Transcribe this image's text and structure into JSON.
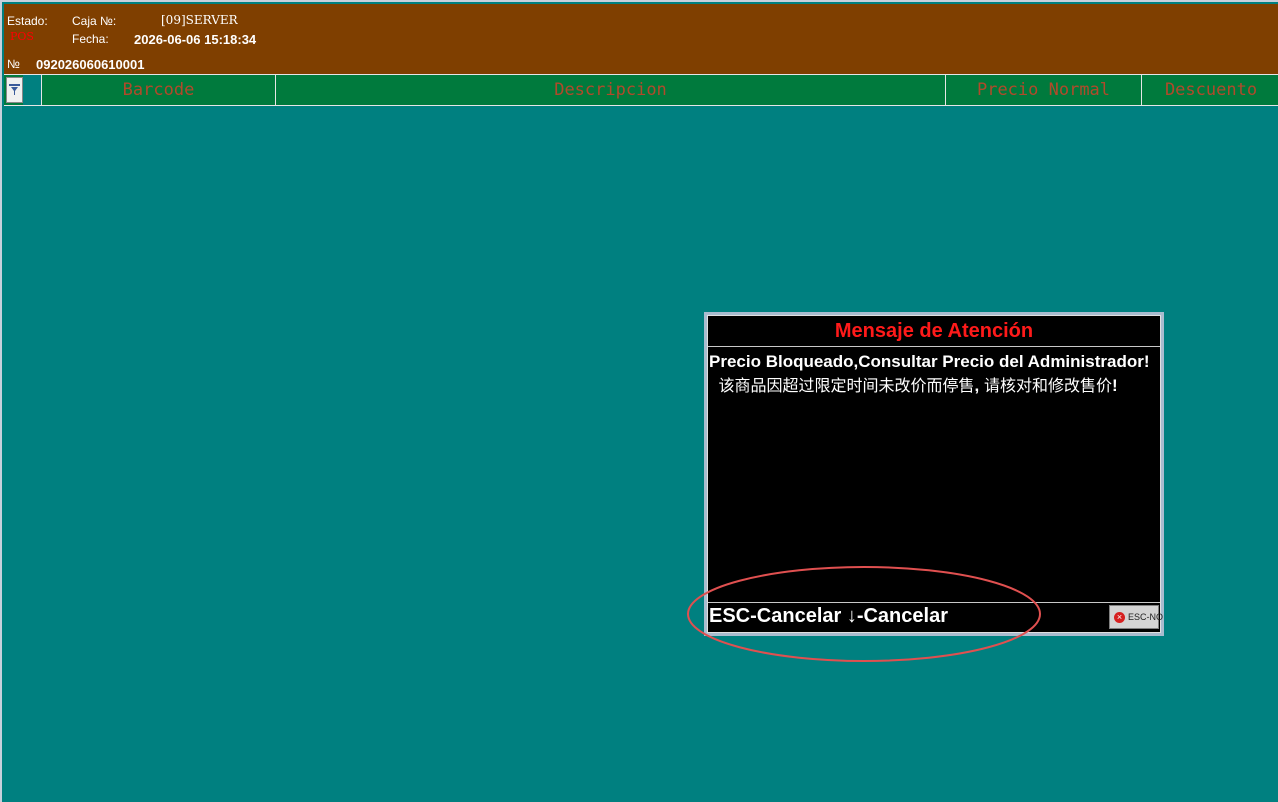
{
  "header": {
    "estado_label": "Estado:",
    "estado_value": "POS",
    "caja_label": "Caja №:",
    "caja_value": "[09]SERVER",
    "fecha_label": "Fecha:",
    "fecha_value": "2026-06-06 15:18:34",
    "numero_label": "№",
    "numero_value": "092026060610001"
  },
  "grid": {
    "corner_icon": "filter-icon",
    "columns": [
      "Barcode",
      "Descripcion",
      "Precio Normal",
      "Descuento"
    ]
  },
  "dialog": {
    "title": "Mensaje de Atención",
    "message_es": "Precio Bloqueado,Consultar Precio del Administrador!",
    "message_cn": "该商品因超过限定时间未改价而停售",
    "message_cn_punct": ",",
    "message_cn2": "请核对和修改售价",
    "message_end": "!",
    "hint": "ESC-Cancelar ↓-Cancelar",
    "esc_button_label": "ESC-NO",
    "esc_button_icon": "close-circle-icon"
  },
  "colors": {
    "background": "#008080",
    "header": "#7f3f00",
    "grid_header": "#007a3d",
    "dialog_title": "#ff1a1a",
    "annotation": "#e05050"
  }
}
